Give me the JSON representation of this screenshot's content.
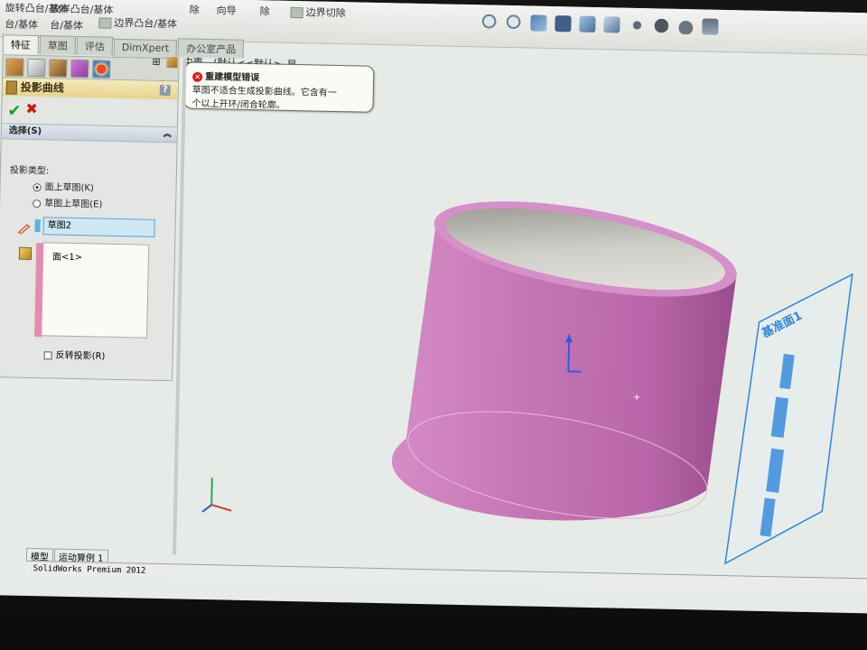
{
  "ribbon": {
    "items": [
      "旋转凸台/基体",
      "放样凸台/基体",
      "边界凸台/基体",
      "除",
      "向导",
      "除",
      "边界切除"
    ],
    "partial": [
      "台/基体",
      "台/基体"
    ]
  },
  "tabs": [
    {
      "label": "特征",
      "active": true
    },
    {
      "label": "草图",
      "active": false
    },
    {
      "label": "评估",
      "active": false
    },
    {
      "label": "DimXpert",
      "active": false
    },
    {
      "label": "办公室产品",
      "active": false
    }
  ],
  "tree": {
    "expander": "⊞",
    "label": "中壳",
    "config": "(默认<<默认>_显..."
  },
  "tooltip": {
    "title": "重建模型错误",
    "line1": "草图不适合生成投影曲线。它含有一",
    "line2": "个以上开环/闭合轮廓。"
  },
  "feature": {
    "title": "投影曲线",
    "help": "?",
    "ok": "✔",
    "cancel": "✖",
    "section": "选择(S)",
    "type_label": "投影类型:",
    "options": [
      {
        "label": "面上草图(K)",
        "selected": true
      },
      {
        "label": "草图上草图(E)",
        "selected": false
      }
    ],
    "sketch_selection": "草图2",
    "face_selection": "面<1>",
    "reverse_label": "反转投影(R)",
    "reverse_checked": false
  },
  "plane_label": "基准面1",
  "bottom_tabs": [
    "模型",
    "运动算例 1"
  ],
  "status": "SolidWorks Premium 2012",
  "colors": {
    "part": "#c86eb2",
    "part_dark": "#8c3e80",
    "inner": "#b9b8b0",
    "plane_edge": "#2f86d8",
    "title_bar": "#e6d48e"
  },
  "icons": [
    "zoom-fit-icon",
    "zoom-area-icon",
    "previous-view-icon",
    "section-view-icon",
    "view-orientation-icon",
    "display-style-icon",
    "hide-show-icon",
    "appearance-icon",
    "scene-icon",
    "view-settings-icon"
  ]
}
